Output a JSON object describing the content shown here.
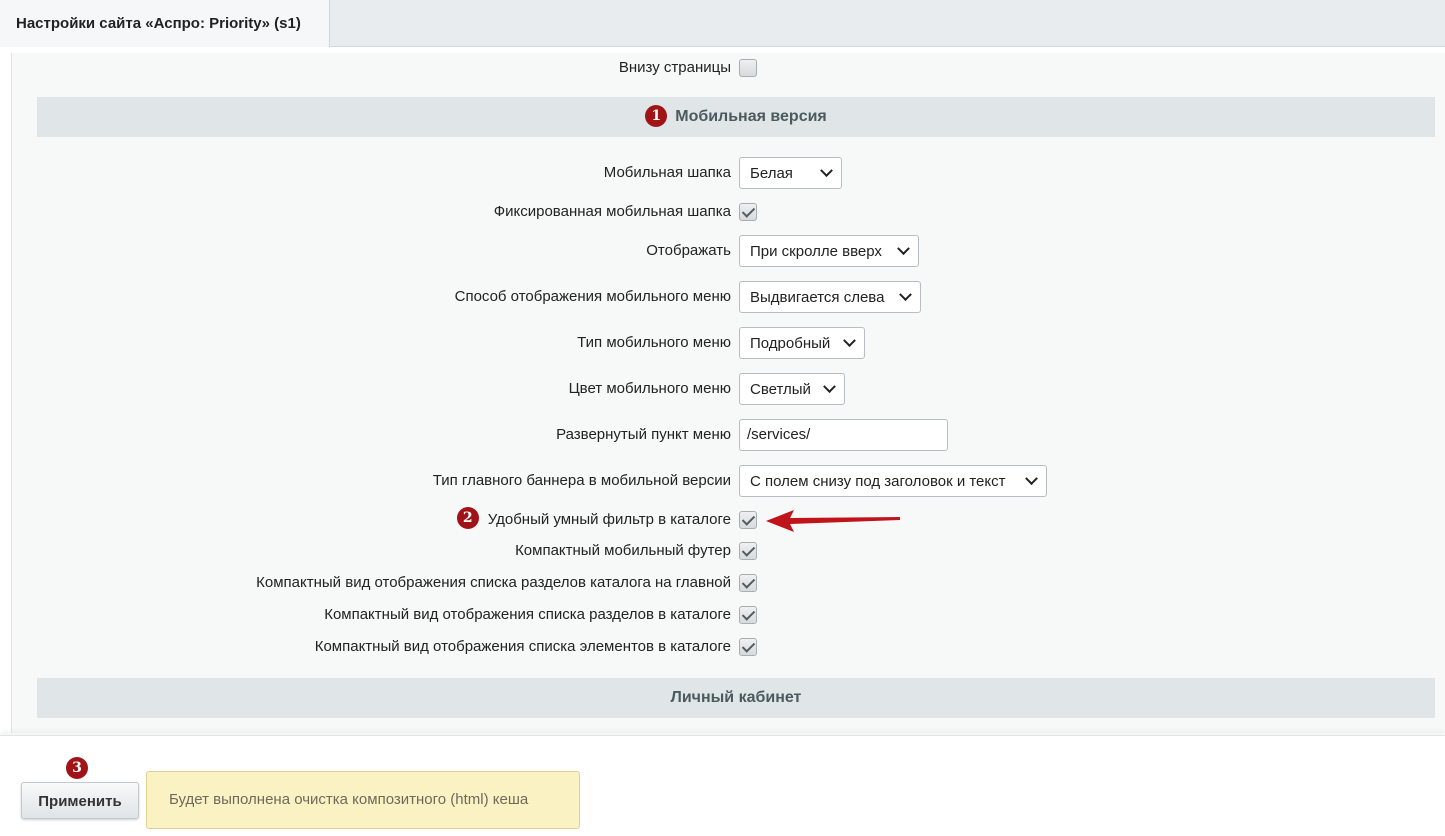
{
  "tab": {
    "title": "Настройки сайта «Аспро: Priority» (s1)"
  },
  "top_row": {
    "label": "Внизу страницы",
    "checked": false
  },
  "sections": {
    "mobile": {
      "title": "Мобильная версия",
      "marker": "1"
    },
    "cabinet": {
      "title": "Личный кабинет"
    }
  },
  "rows": {
    "mobile_header": {
      "label": "Мобильная шапка",
      "value": "Белая"
    },
    "fixed_mobile_header": {
      "label": "Фиксированная мобильная шапка",
      "checked": true
    },
    "display": {
      "label": "Отображать",
      "value": "При скролле вверх"
    },
    "menu_display_mode": {
      "label": "Способ отображения мобильного меню",
      "value": "Выдвигается слева"
    },
    "menu_type": {
      "label": "Тип мобильного меню",
      "value": "Подробный"
    },
    "menu_color": {
      "label": "Цвет мобильного меню",
      "value": "Светлый"
    },
    "expanded_menu_item": {
      "label": "Развернутый пункт меню",
      "value": "/services/"
    },
    "main_banner_type": {
      "label": "Тип главного баннера в мобильной версии",
      "value": "С полем снизу под заголовок и текст"
    },
    "smart_filter": {
      "label": "Удобный умный фильтр в каталоге",
      "checked": true,
      "marker": "2"
    },
    "compact_footer": {
      "label": "Компактный мобильный футер",
      "checked": true
    },
    "compact_sections_main": {
      "label": "Компактный вид отображения списка разделов каталога на главной",
      "checked": true
    },
    "compact_sections_catalog": {
      "label": "Компактный вид отображения списка разделов в каталоге",
      "checked": true
    },
    "compact_elements_catalog": {
      "label": "Компактный вид отображения списка элементов в каталоге",
      "checked": true
    }
  },
  "footer": {
    "apply_label": "Применить",
    "apply_marker": "3",
    "notice": "Будет выполнена очистка композитного (html) кеша"
  },
  "colors": {
    "marker": "#a01418",
    "arrow": "#c0141b",
    "section_bg": "#e0e6e7",
    "notice_bg": "#fbf2c4"
  }
}
